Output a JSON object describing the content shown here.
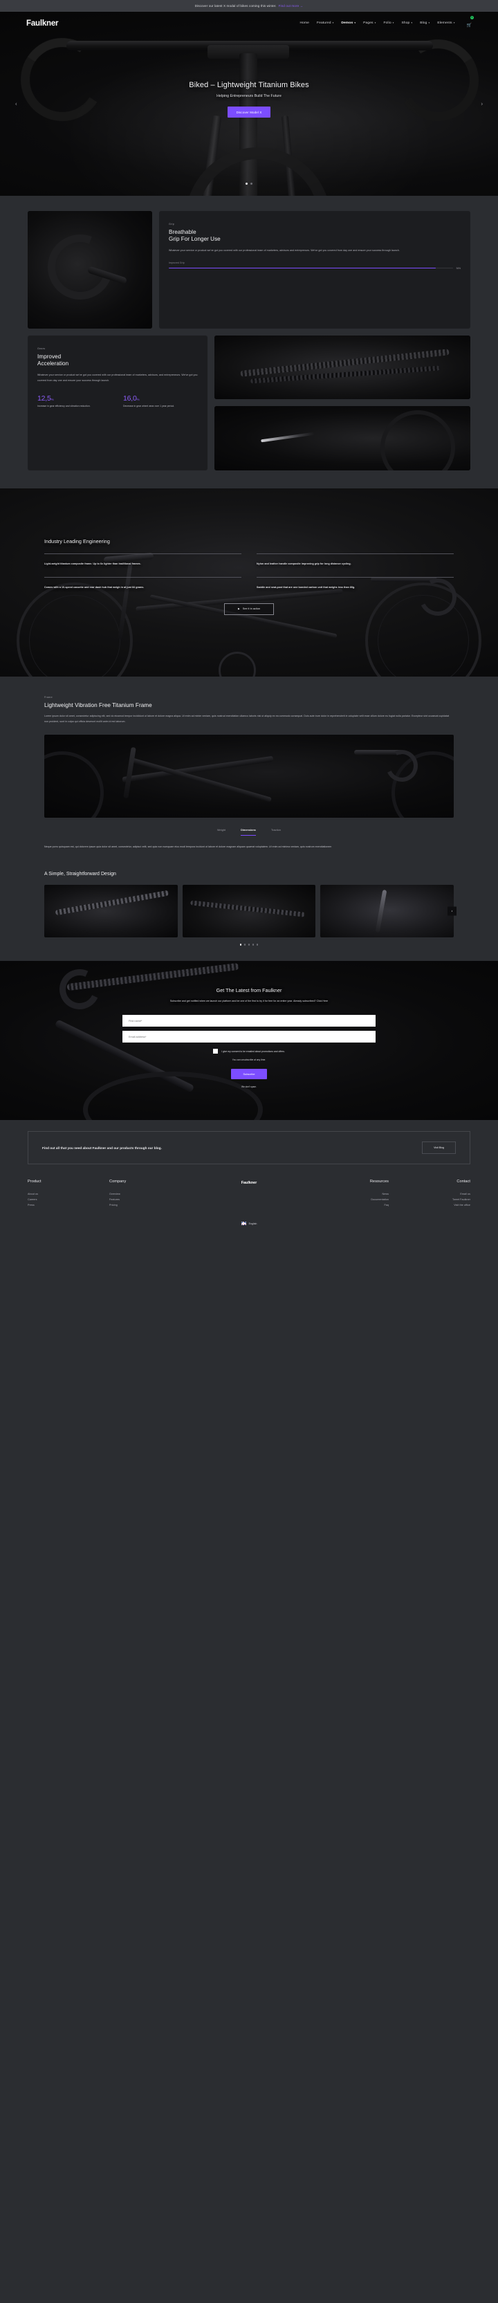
{
  "announcement": {
    "text": "Discover our latest X modal of bikes coming this winter.",
    "link": "Find out more →"
  },
  "header": {
    "brand": "Faulkner",
    "nav": [
      {
        "label": "Home",
        "has_caret": false,
        "active": false
      },
      {
        "label": "Featured",
        "has_caret": true,
        "active": false
      },
      {
        "label": "Demos",
        "has_caret": true,
        "active": true
      },
      {
        "label": "Pages",
        "has_caret": true,
        "active": false
      },
      {
        "label": "Folio",
        "has_caret": true,
        "active": false
      },
      {
        "label": "Shop",
        "has_caret": true,
        "active": false
      },
      {
        "label": "Blog",
        "has_caret": true,
        "active": false
      },
      {
        "label": "Elements",
        "has_caret": true,
        "active": false
      }
    ],
    "cart_icon": "shopping-cart-icon",
    "cart_count": "0"
  },
  "hero": {
    "title": "Biked – Lightweight Titanium Bikes",
    "subtitle": "Helping Entrepreneurs Build The Future",
    "cta": "Discover Model X",
    "prev_icon": "chevron-left-icon",
    "next_icon": "chevron-right-icon",
    "slides": 2,
    "active_slide": 1
  },
  "cards": {
    "grip": {
      "kicker": "Grip",
      "title_line1": "Breathable",
      "title_line2": "Grip For Longer Use",
      "body": "Whatever your service or product we've got you covered with our professional team of marketers, advisors and entreprenurs. We've got you covered from day one and ensure your success through launch.",
      "bar_label": "Improved Grip",
      "bar_pct": "94%",
      "bar_value": 94
    },
    "gears": {
      "kicker": "Gears",
      "title_line1": "Improved",
      "title_line2": "Acceleration",
      "body": "Whatever your service or product we've got you covered with our professional team of marketers, advisors, and entrepreneurs. We've got you covered from day one and ensure your success through launch.",
      "stats": [
        {
          "number": "12,5",
          "unit": "%",
          "text": "Increase in gear efficiency and vibration reduction."
        },
        {
          "number": "16,0",
          "unit": "%",
          "text": "Decrease in gear wheel wear over 1 year period."
        }
      ]
    },
    "photo_handlebar_alt": "bike-handlebar-photo",
    "photo_chain_alt": "bike-chain-photo",
    "photo_hub_alt": "bike-hub-photo"
  },
  "engineering": {
    "title": "Industry Leading Engineering",
    "features": [
      "Light-weight titanium composite frame. Up to 6x lighter than traditional frames.",
      "Nylon and leather handle composite improving grip for long distance cycling.",
      "Comes with a 10-speed cassette and rear dash hub that weigh in at just 84 grams.",
      "Saddle and seat-post that are one bonded carbon unit that weighs less than 80g."
    ],
    "cta": "See it in action",
    "cta_icon": "play-icon"
  },
  "frame": {
    "kicker": "Frame",
    "title": "Lightweight Vibration Free Titanium Frame",
    "body": "Lorem ipsum dolor sit amet, consectetur adipiscing elit, sed do eiusmod tempor incididunt ut labore et dolore magna aliqua. Ut enim ad minim veniam, quis nostrud exercitation ullamco laboris nisi ut aliquip ex ea commodo consequat. Duis aute irure dolor in reprehenderit in voluptate velit esse cillum dolore eu fugiat nulla pariatur. Excepteur sint occaecat cupidatat non proident, sunt in culpa qui officia deserunt mollit anim id est laborum.",
    "image_alt": "titanium-frame-photo",
    "tabs": [
      {
        "label": "Weight",
        "active": false
      },
      {
        "label": "Dimensions",
        "active": true
      },
      {
        "label": "Traction",
        "active": false
      }
    ],
    "tab_body": "Neque porro quisquam est, qui dolorem ipsum quia dolor sit amet, consectetur, adipisci velit, sed quia non numquam eius modi tempora incidunt ut labore et dolore magnam aliquam quaerat voluptatem. Ut enim ad minima veniam, quis nostrum exercitationem"
  },
  "gallery": {
    "title": "A Simple, Straightforward Design",
    "items": [
      {
        "alt": "brake-caliper-photo"
      },
      {
        "alt": "chainring-photo"
      },
      {
        "alt": "seatpost-photo"
      }
    ],
    "next_icon": "chevron-right-icon",
    "dots": 5,
    "active_dot": 1
  },
  "newsletter": {
    "title": "Get The Latest from Faulkner",
    "description": "Subscribe and get notified when we launch our platform and be one of the first to try it for free for an entire year. Already subscribed? Click Here",
    "first_name_placeholder": "First name*",
    "email_placeholder": "Email address*",
    "consent": "I give my consent to be emailed about promotions and offers.",
    "unsubscribe_note": "You can unsubscribe at any time.",
    "submit": "Subscribe",
    "spam_note": "We don't spam."
  },
  "footer": {
    "blog_cta_text": "Find out all that you need about Faulkner and our products through our blog.",
    "blog_cta_button": "Visit Blog",
    "brand": "Faulkner",
    "columns": [
      {
        "title": "Product",
        "links": [
          "About us",
          "Careers",
          "Press"
        ]
      },
      {
        "title": "Company",
        "links": [
          "Overview",
          "Features",
          "Pricing"
        ]
      },
      {
        "title": "Resources",
        "links": [
          "News",
          "Documentation",
          "Faq"
        ]
      },
      {
        "title": "Contact",
        "links": [
          "Email us",
          "Tweet Faulkner",
          "Visit the office"
        ]
      }
    ],
    "language": "English",
    "flag_icon": "uk-flag-icon"
  },
  "colors": {
    "accent": "#7c4dff",
    "page_bg": "#2b2d31",
    "card_bg": "#1c1d20",
    "badge_green": "#22c55e"
  }
}
